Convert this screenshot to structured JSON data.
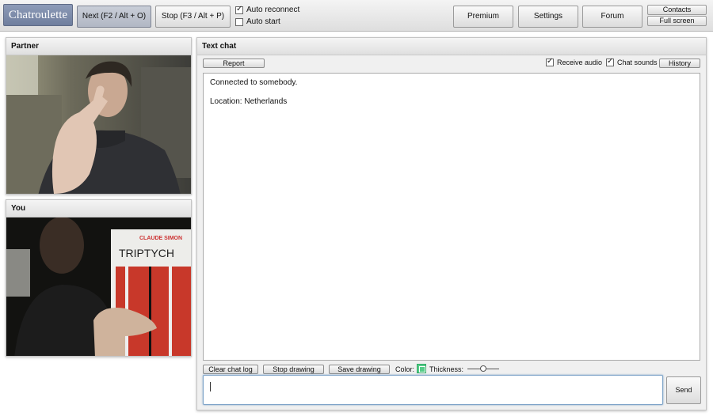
{
  "app": {
    "logo": "Chatroulette"
  },
  "toolbar": {
    "next_label": "Next (F2 / Alt + O)",
    "stop_label": "Stop (F3 / Alt + P)",
    "auto_reconnect": {
      "label": "Auto reconnect",
      "checked": true
    },
    "auto_start": {
      "label": "Auto start",
      "checked": false
    },
    "premium_label": "Premium",
    "settings_label": "Settings",
    "forum_label": "Forum",
    "contacts_label": "Contacts",
    "fullscreen_label": "Full screen"
  },
  "partner": {
    "title": "Partner"
  },
  "you": {
    "title": "You",
    "book_author": "CLAUDE SIMON",
    "book_title": "TRIPTYCH"
  },
  "chat": {
    "title": "Text chat",
    "report_label": "Report",
    "receive_audio": {
      "label": "Receive audio",
      "checked": true
    },
    "chat_sounds": {
      "label": "Chat sounds",
      "checked": true
    },
    "history_label": "History",
    "messages": [
      "Connected to somebody.",
      "Location: Netherlands"
    ],
    "input_value": "",
    "send_label": "Send"
  },
  "drawing": {
    "clear_label": "Clear chat log",
    "stop_label": "Stop drawing",
    "save_label": "Save drawing",
    "color_label": "Color:",
    "thickness_label": "Thickness:",
    "thickness_level": 0.5,
    "color": "#55cc88"
  },
  "colors": {
    "logo_bg": "#7d8aa8",
    "input_focus": "#7da3c8"
  }
}
